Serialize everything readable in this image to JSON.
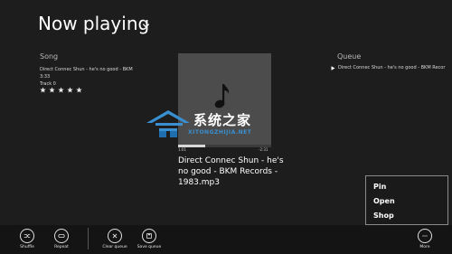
{
  "header": {
    "title": "Now playing"
  },
  "song": {
    "section_label": "Song",
    "lines": [
      "Direct Connec Shun - he's no good - BKM",
      "3:33",
      "Track 0"
    ],
    "rating": 0
  },
  "queue": {
    "section_label": "Queue",
    "items": [
      {
        "label": "Direct Connec Shun - he's no good - BKM Recor",
        "playing": true
      }
    ]
  },
  "now_playing": {
    "track_title": "Direct Connec Shun - he's no good - BKM Records - 1983.mp3",
    "elapsed": "1:01",
    "remaining": "-2:31",
    "progress": 0.29
  },
  "watermark": {
    "text": "系统之家",
    "subtext": "XITONGZHIJIA.NET"
  },
  "appbar": {
    "buttons": [
      {
        "id": "shuffle",
        "label": "Shuffle",
        "icon": "shuffle-icon"
      },
      {
        "id": "repeat",
        "label": "Repeat",
        "icon": "repeat-icon"
      },
      {
        "id": "clear-queue",
        "label": "Clear queue",
        "icon": "close-icon"
      },
      {
        "id": "save-queue",
        "label": "Save queue",
        "icon": "save-icon"
      },
      {
        "id": "more",
        "label": "More",
        "icon": "more-icon"
      }
    ]
  },
  "context_menu": {
    "items": [
      "Pin",
      "Open",
      "Shop"
    ]
  },
  "colors": {
    "background": "#1d1d1d",
    "album_art": "#4c4c4c",
    "appbar": "#141414",
    "watermark_accent": "#3a8fd0"
  }
}
